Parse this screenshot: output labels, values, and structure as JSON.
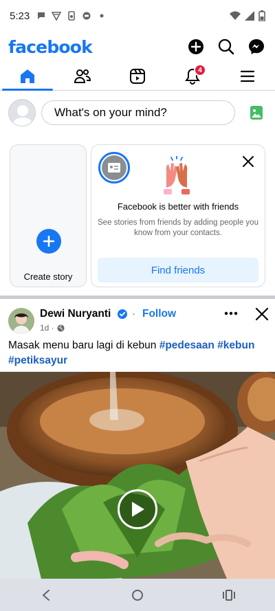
{
  "status_bar": {
    "time": "5:23",
    "icons": [
      "chat-notification-icon",
      "vpn-icon",
      "device-icon",
      "app-icon",
      "dot-icon",
      "wifi-icon",
      "signal-icon",
      "battery-icon"
    ]
  },
  "header": {
    "logo_text": "facebook",
    "actions": [
      "create-icon",
      "search-icon",
      "messenger-icon"
    ]
  },
  "tabs": {
    "items": [
      {
        "name": "home",
        "icon": "home-icon",
        "active": true
      },
      {
        "name": "friends",
        "icon": "friends-icon"
      },
      {
        "name": "video",
        "icon": "video-icon"
      },
      {
        "name": "notifications",
        "icon": "bell-icon",
        "badge": "4"
      },
      {
        "name": "menu",
        "icon": "menu-icon"
      }
    ]
  },
  "composer": {
    "placeholder": "What's on your mind?"
  },
  "stories": {
    "create_label": "Create story",
    "friends_card": {
      "title": "Facebook is better with friends",
      "subtitle": "See stories from friends by adding people you know from your contacts.",
      "button_label": "Find friends"
    }
  },
  "post": {
    "author": "Dewi Nuryanti",
    "separator": "·",
    "follow_label": "Follow",
    "time": "1d ·",
    "text_prefix": "Masak menu baru lagi di kebun ",
    "hashtags": [
      "#pedesaan",
      "#kebun",
      "#petiksayur"
    ]
  },
  "colors": {
    "brand": "#1877f2",
    "badge": "#e41e3f",
    "hashtag": "#1b5fbf"
  }
}
